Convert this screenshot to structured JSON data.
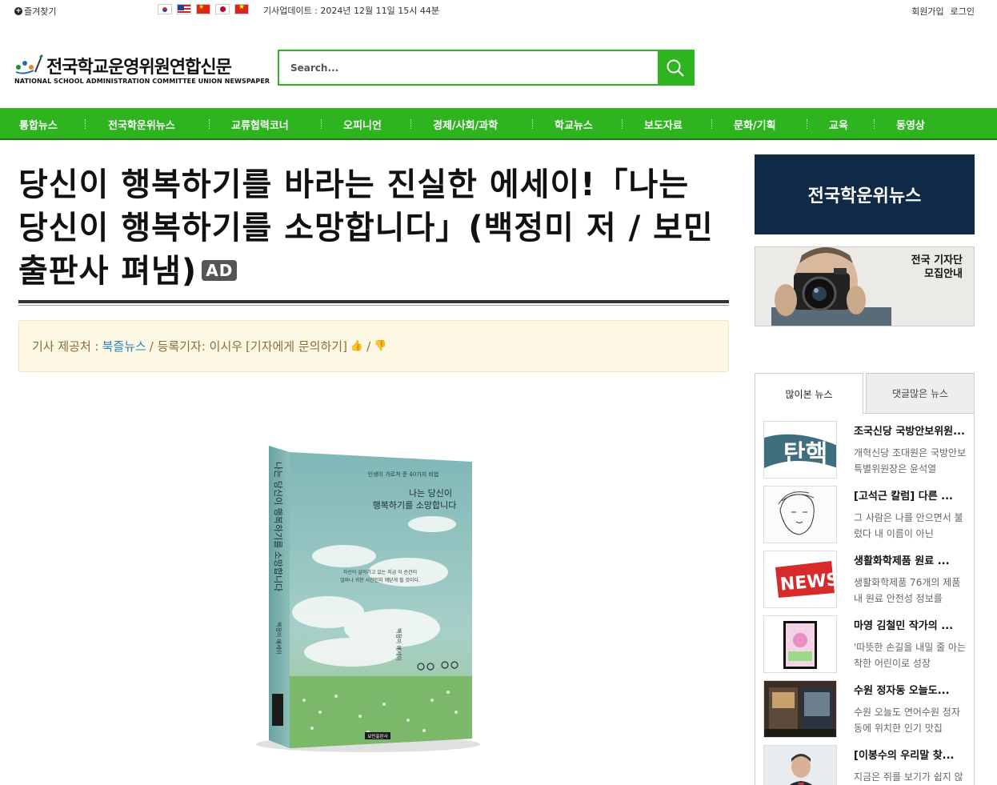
{
  "topbar": {
    "favorite_label": "즐겨찾기",
    "updated": "기사업데이트 : 2024년 12월 11일 15시 44분",
    "signup": "회원가입",
    "login": "로그인",
    "languages": [
      "korean-flag-icon",
      "us-flag-icon",
      "china-flag-icon",
      "japan-flag-icon",
      "vietnam-flag-icon"
    ]
  },
  "brand": {
    "title": "전국학교운영위원연합신문",
    "subtitle": "NATIONAL SCHOOL ADMINISTRATION COMMITTEE UNION NEWSPAPER",
    "accent": "#2db41f"
  },
  "search": {
    "placeholder": "Search..."
  },
  "nav": {
    "items": [
      "통합뉴스",
      "전국학운위뉴스",
      "교류협력코너",
      "오피니언",
      "경제/사회/과학",
      "학교뉴스",
      "보도자료",
      "문화/기획",
      "교육",
      "동영상"
    ]
  },
  "article": {
    "headline": "당신이 행복하기를 바라는 진실한 에세이!「나는 당신이 행복하기를 소망합니다」(백정미 저 / 보민출판사 펴냄)",
    "ad_badge": "AD",
    "byline": {
      "provider_label": "기사 제공처 :",
      "provider": "북즐뉴스",
      "reporter_label": "/ 등록기자: 이시우",
      "contact": "[기자에게 문의하기]",
      "separator": "/"
    },
    "book_cover": {
      "tagline": "인생이 가르쳐 준 40가지 비법",
      "title_line1": "나는 당신이",
      "title_line2": "행복하기를 소망합니다",
      "blurb_line1": "자신이 살아가고 있는 지금 이 순간이",
      "blurb_line2": "얼마나 귀한 시간인지 깨닫게 될 것이다.",
      "author": "백정미 에세이",
      "spine_title": "나는 당신이 행복하기를 소망합니다",
      "spine_author": "백정미 에세이",
      "publisher": "보민출판사"
    }
  },
  "sidebar": {
    "banner": "전국학운위뉴스",
    "recruit_line1": "전국 기자단",
    "recruit_line2": "모집안내",
    "tabs": [
      "많이본 뉴스",
      "댓글많은 뉴스"
    ],
    "news": [
      {
        "title": "조국신당 국방안보위원...",
        "desc": "개혁신당 조대원은 국방안보특별위원장은 윤석열",
        "thumb": "impeachment-thumb",
        "thumb_text": "탄핵"
      },
      {
        "title": "[고석근 칼럼] 다른 ...",
        "desc": "그 사람은 나를 안으면서 불렀다 내 이름이 아닌",
        "thumb": "sketch-portrait-thumb",
        "thumb_text": ""
      },
      {
        "title": "생활화학제품 원료 ...",
        "desc": "생활화학제품 76개의 제품 내 원료 안전성 정보를",
        "thumb": "news-sign-thumb",
        "thumb_text": "NEWS"
      },
      {
        "title": "마영 김철민 작가의 ...",
        "desc": "'따뜻한 손길을 내밀 줄 아는 착한 어린이로 성장",
        "thumb": "book-thumb",
        "thumb_text": ""
      },
      {
        "title": "수원 정자동 오늘도...",
        "desc": "수원 오늘도 연어수원 정자동에 위치한 인기 맛집",
        "thumb": "restaurant-thumb",
        "thumb_text": ""
      },
      {
        "title": "[이봉수의 우리말 찾...",
        "desc": "지금은 쥐를 보기가 쉽지 않다",
        "thumb": "portrait-thumb",
        "thumb_text": ""
      }
    ]
  }
}
